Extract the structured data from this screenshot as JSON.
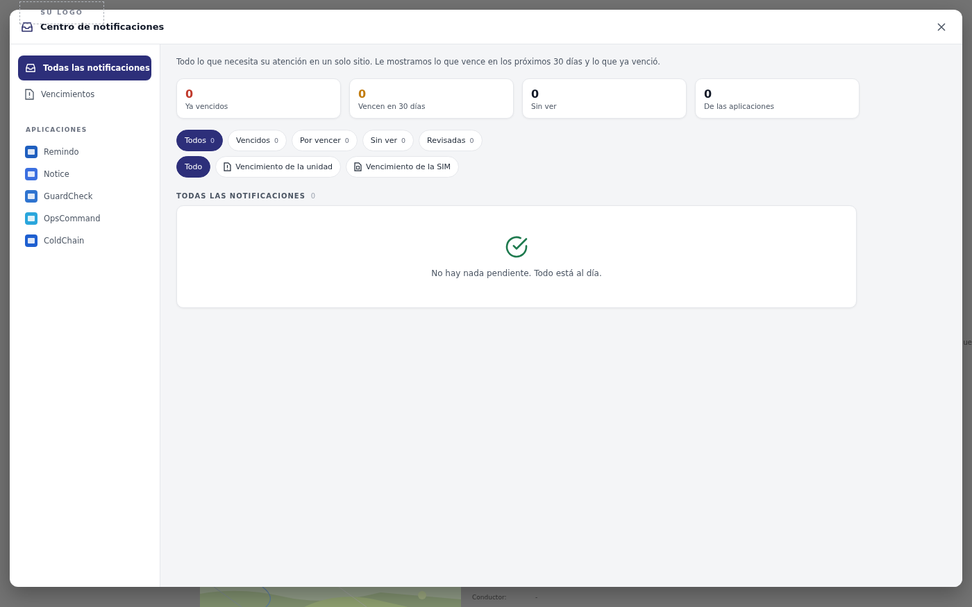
{
  "logo_placeholder": {
    "text": "SU LOGO"
  },
  "background": {
    "fields": [
      {
        "label": "Conductor:",
        "value": "-"
      }
    ],
    "edge_text": "ue"
  },
  "window": {
    "title": "Centro de notificaciones"
  },
  "sidebar": {
    "items": [
      {
        "label": "Todas las notificaciones",
        "kind": "inbox",
        "selected": true
      },
      {
        "label": "Vencimientos",
        "kind": "document",
        "selected": false
      }
    ],
    "section_title": "APLICACIONES",
    "apps": [
      {
        "label": "Remindo",
        "color": "#1f5fbf"
      },
      {
        "label": "Notice",
        "color": "#3b6fe0"
      },
      {
        "label": "GuardCheck",
        "color": "#2f74d0"
      },
      {
        "label": "OpsCommand",
        "color": "#2aa6dc"
      },
      {
        "label": "ColdChain",
        "color": "#1e5fd0"
      }
    ]
  },
  "intro": "Todo lo que necesita su atención en un solo sitio. Le mostramos lo que vence en los próximos 30 días y lo que ya venció.",
  "stats": [
    {
      "value": "0",
      "label": "Ya vencidos",
      "color": "#c0392b"
    },
    {
      "value": "0",
      "label": "Vencen en 30 días",
      "color": "#c27c0e"
    },
    {
      "value": "0",
      "label": "Sin ver",
      "color": "#111827"
    },
    {
      "value": "0",
      "label": "De las aplicaciones",
      "color": "#111827"
    }
  ],
  "status_filters": [
    {
      "label": "Todos",
      "count": "0",
      "selected": true
    },
    {
      "label": "Vencidos",
      "count": "0",
      "selected": false
    },
    {
      "label": "Por vencer",
      "count": "0",
      "selected": false
    },
    {
      "label": "Sin ver",
      "count": "0",
      "selected": false
    },
    {
      "label": "Revisadas",
      "count": "0",
      "selected": false
    }
  ],
  "type_filters": [
    {
      "label": "Todo",
      "kind": "all",
      "selected": true
    },
    {
      "label": "Vencimiento de la unidad",
      "kind": "unit",
      "selected": false
    },
    {
      "label": "Vencimiento de la SIM",
      "kind": "sim",
      "selected": false
    }
  ],
  "list": {
    "title": "TODAS LAS NOTIFICACIONES",
    "count": "0",
    "empty_message": "No hay nada pendiente. Todo está al día."
  }
}
